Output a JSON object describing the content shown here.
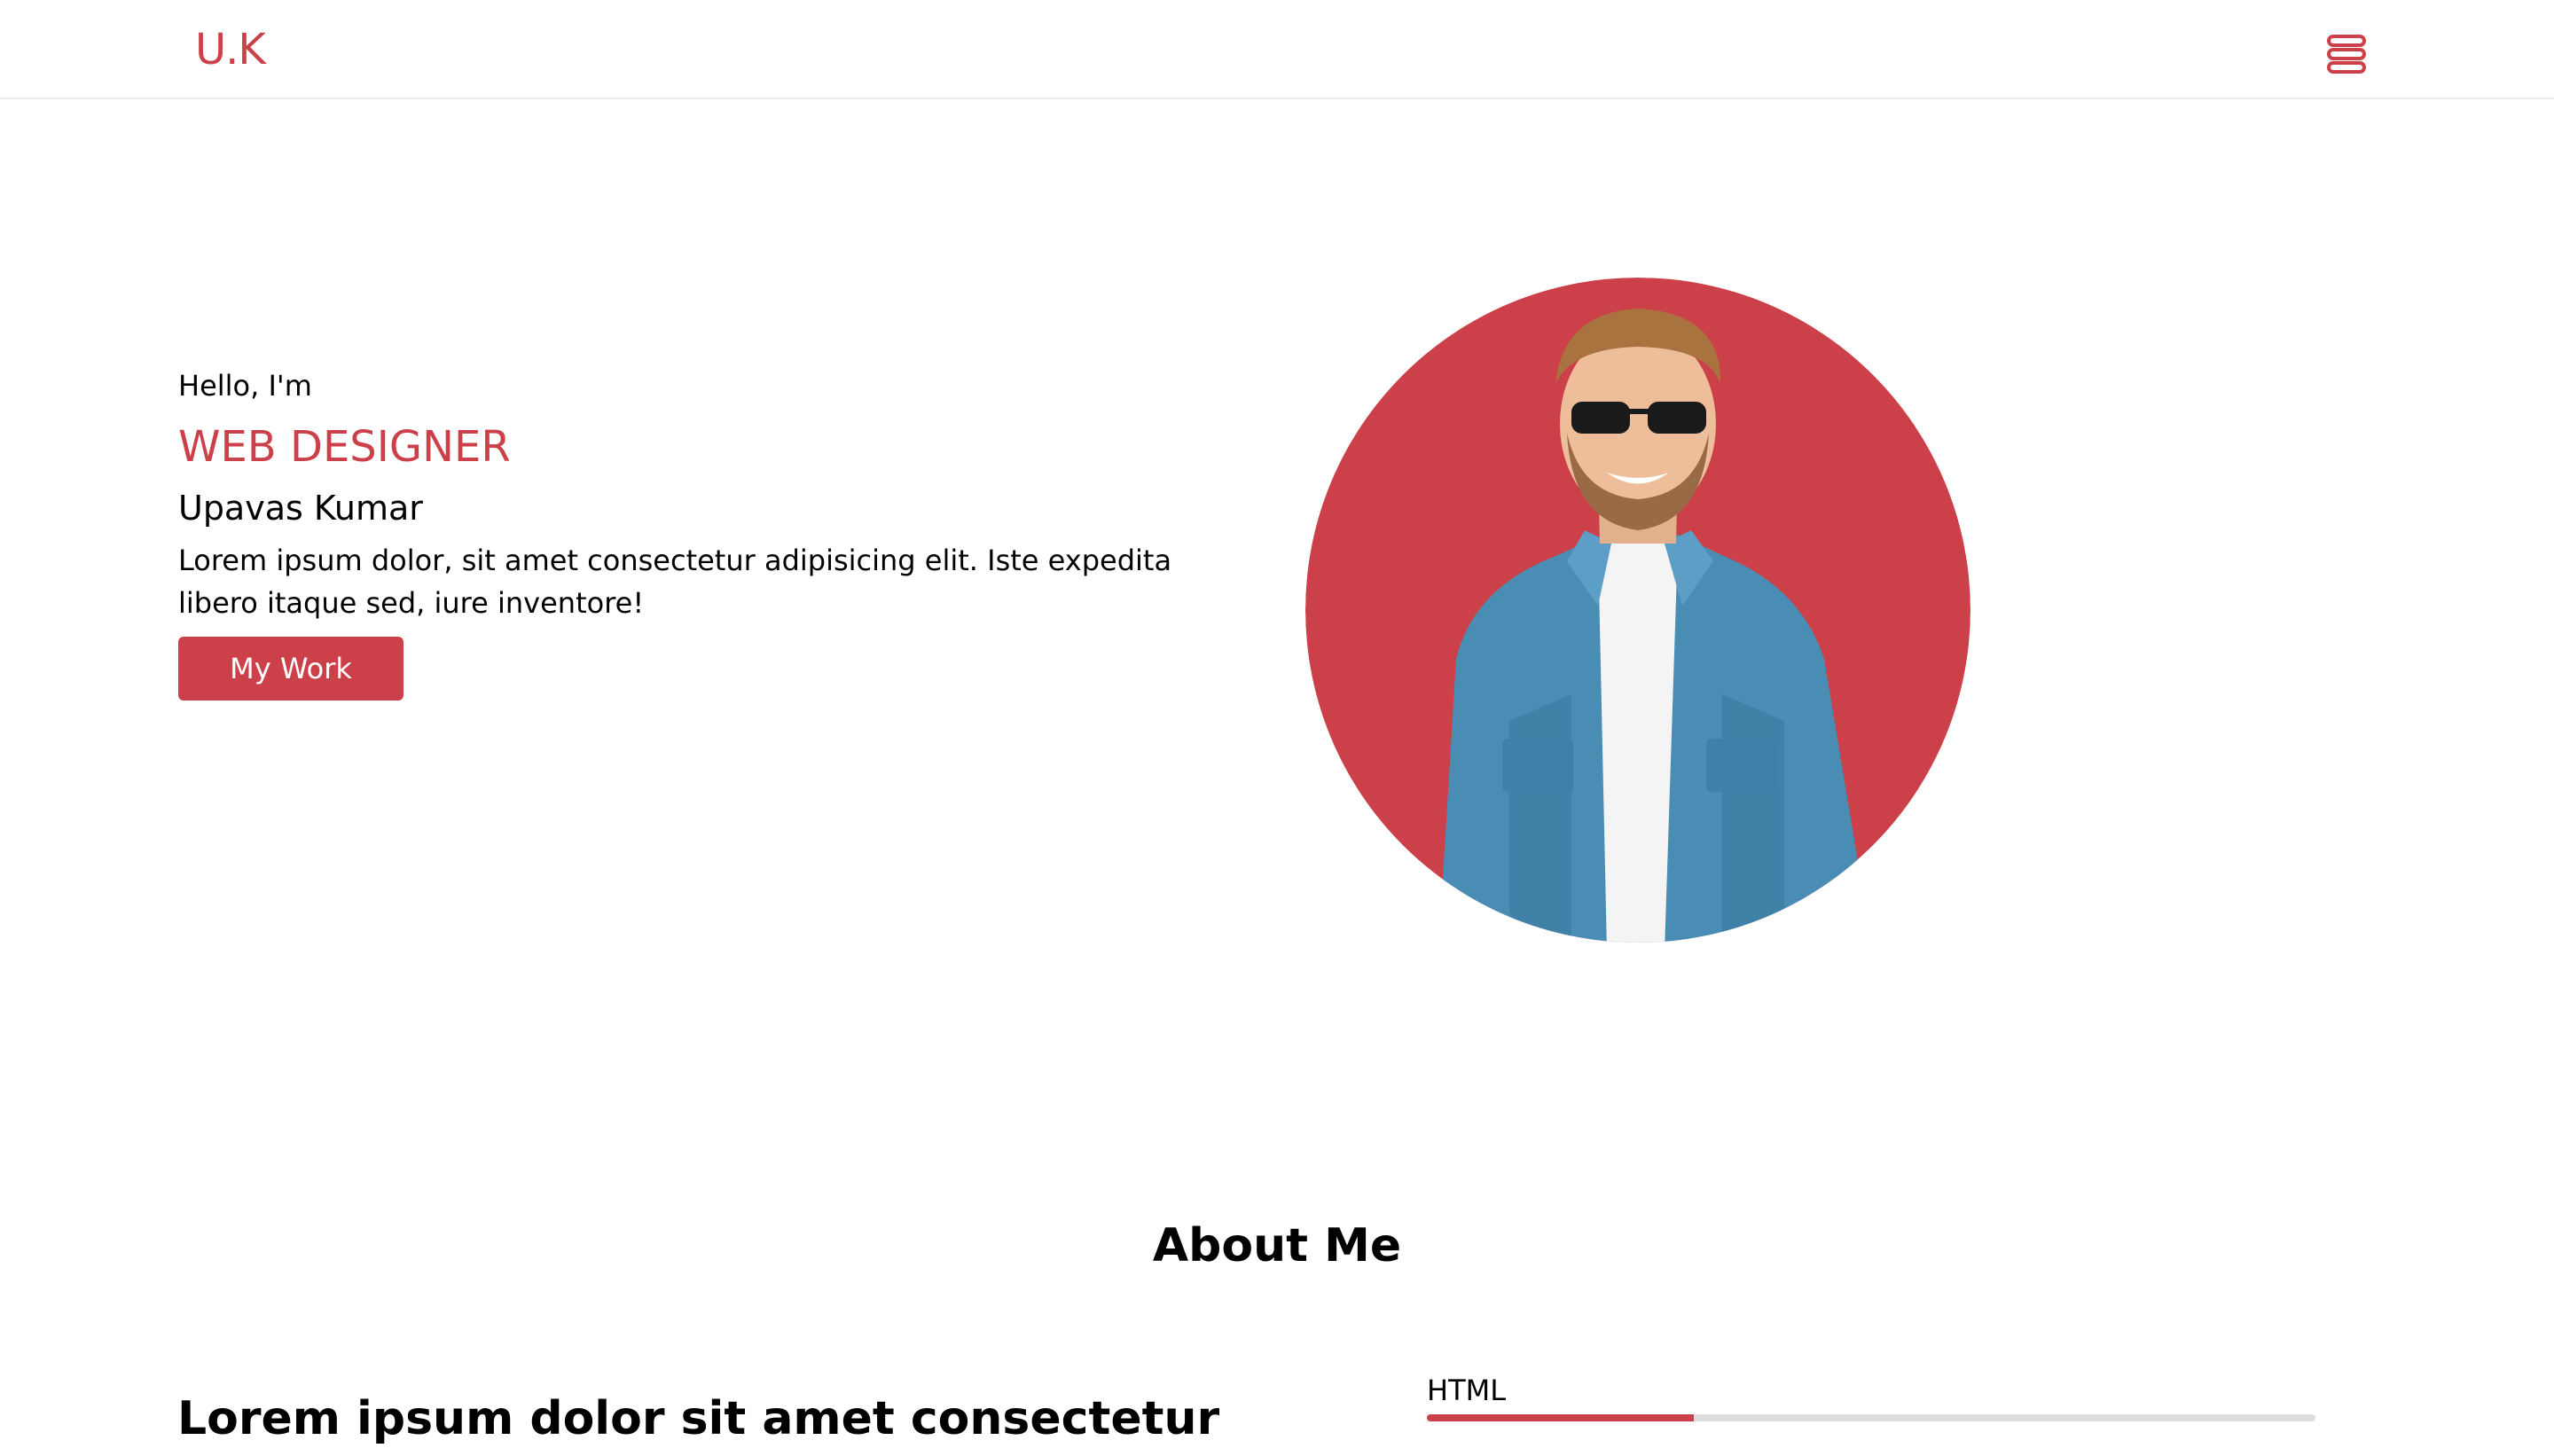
{
  "colors": {
    "accent": "#cc4149",
    "text": "#000000",
    "track": "#dddddd",
    "header_border": "#ececec",
    "background": "#ffffff"
  },
  "header": {
    "logo": "U.K",
    "menu_icon": "hamburger-menu-icon"
  },
  "hero": {
    "greeting": "Hello, I'm",
    "role": "WEB DESIGNER",
    "name": "Upavas Kumar",
    "bio": "Lorem ipsum dolor, sit amet consectetur adipisicing elit. Iste expedita libero itaque sed, iure inventore!",
    "button_label": "My Work",
    "portrait": "profile-portrait"
  },
  "about": {
    "title": "About Me",
    "subtitle": "Lorem ipsum dolor sit amet consectetur",
    "skills": [
      {
        "label": "HTML",
        "level_percent": 30
      }
    ]
  }
}
